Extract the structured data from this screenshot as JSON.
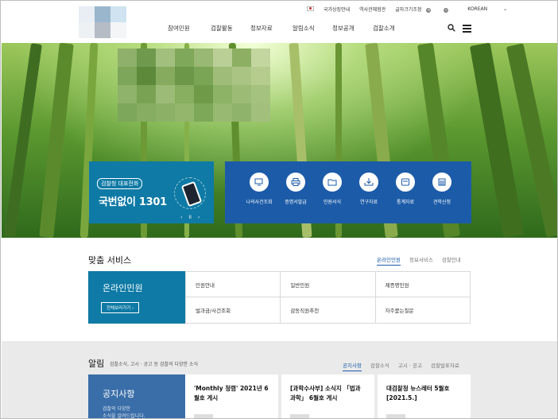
{
  "header": {
    "util_links": [
      "국가상징안내",
      "역사관체험관",
      "글자크기조정",
      "KOREAN"
    ],
    "font_size_controls": [
      "+",
      "−"
    ],
    "nav": [
      "참여민원",
      "검찰활동",
      "정보자료",
      "알림소식",
      "정보공개",
      "검찰소개"
    ]
  },
  "hero": {
    "phone_tag": "검찰청 대표전화",
    "phone_text": "국번없이 1301",
    "slider_controls": [
      "‹",
      "II",
      "›"
    ],
    "quick_menu": [
      {
        "label": "나의사건조회",
        "icon": "monitor-search-icon"
      },
      {
        "label": "증명서발급",
        "icon": "printer-icon"
      },
      {
        "label": "민원서식",
        "icon": "folder-icon"
      },
      {
        "label": "연구자료",
        "icon": "download-icon"
      },
      {
        "label": "통계자료",
        "icon": "inbox-icon"
      },
      {
        "label": "견학신청",
        "icon": "building-icon"
      }
    ]
  },
  "services": {
    "title": "맞춤 서비스",
    "tabs": [
      "온라인민원",
      "정보서비스",
      "검찰안내"
    ],
    "active_tab": "온라인민원",
    "panel_title": "온라인민원",
    "panel_button": "전체보러가기 ›",
    "items": [
      "민원안내",
      "일반민원",
      "제증명민원",
      "벌과금/사건조회",
      "감동직원추천",
      "자주묻는질문"
    ]
  },
  "notice": {
    "title": "알림",
    "subtitle": "검찰소식, 고시 · 공고 등 검찰의 다양한 소식",
    "tabs": [
      "공지사항",
      "검찰소식",
      "고시 · 공고",
      "검찰발표자료"
    ],
    "active_tab": "공지사항",
    "panel_title": "공지사항",
    "panel_desc": [
      "검찰의 다양한",
      "소식을 알려드립니다."
    ],
    "cards": [
      "'Monthly 청렴' 2021년 6월호 게시",
      "[과학수사부] 소식지 「법과 과학」 6월호 게시",
      "대검찰청 뉴스레터 5월호[2021.5.]"
    ]
  },
  "colors": {
    "primary_blue": "#1c5ba8",
    "teal_blue": "#0e7aa5",
    "notice_blue": "#3a6ea8"
  }
}
